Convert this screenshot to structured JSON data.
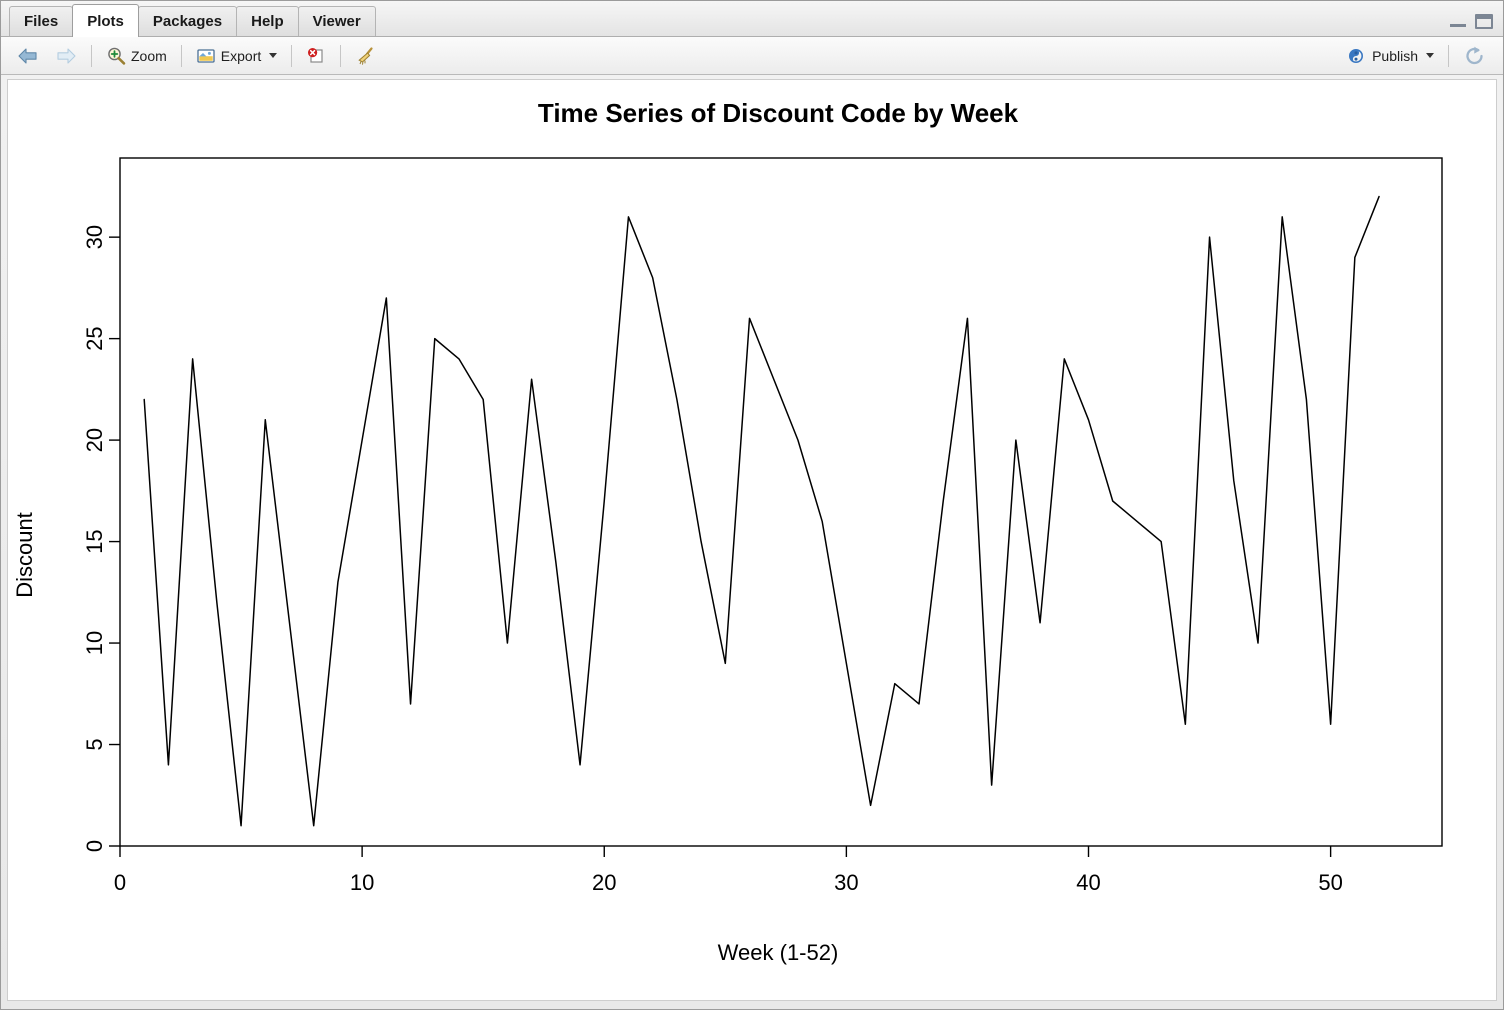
{
  "window": {
    "minimize_icon": "minimize-icon",
    "maximize_icon": "maximize-icon"
  },
  "tabs": [
    {
      "label": "Files",
      "active": false
    },
    {
      "label": "Plots",
      "active": true
    },
    {
      "label": "Packages",
      "active": false
    },
    {
      "label": "Help",
      "active": false
    },
    {
      "label": "Viewer",
      "active": false
    }
  ],
  "toolbar": {
    "back_icon": "back-arrow-icon",
    "forward_icon": "forward-arrow-icon",
    "zoom_label": "Zoom",
    "zoom_icon": "magnifier-plus-icon",
    "export_label": "Export",
    "export_icon": "export-image-icon",
    "export_caret": "chevron-down-icon",
    "remove_icon": "remove-plot-icon",
    "clear_icon": "broom-clear-all-icon",
    "publish_label": "Publish",
    "publish_icon": "publish-icon",
    "publish_caret": "chevron-down-icon",
    "refresh_icon": "refresh-icon"
  },
  "chart_data": {
    "type": "line",
    "title": "Time Series of Discount Code by Week",
    "xlabel": "Week (1-52)",
    "ylabel": "Discount",
    "xlim": [
      1,
      52
    ],
    "ylim": [
      0,
      32
    ],
    "xticks": [
      0,
      10,
      20,
      30,
      40,
      50
    ],
    "yticks": [
      0,
      5,
      10,
      15,
      20,
      25,
      30
    ],
    "grid": false,
    "legend": null,
    "line_color": "#000000",
    "line_width": 1,
    "x": [
      1,
      2,
      3,
      4,
      5,
      6,
      7,
      8,
      9,
      10,
      11,
      12,
      13,
      14,
      15,
      16,
      17,
      18,
      19,
      20,
      21,
      22,
      23,
      24,
      25,
      26,
      27,
      28,
      29,
      30,
      31,
      32,
      33,
      34,
      35,
      36,
      37,
      38,
      39,
      40,
      41,
      42,
      43,
      44,
      45,
      46,
      47,
      48,
      49,
      50,
      51,
      52
    ],
    "values": [
      22,
      4,
      24,
      12,
      1,
      21,
      11,
      1,
      13,
      20,
      27,
      7,
      25,
      24,
      22,
      10,
      23,
      14,
      4,
      17,
      31,
      28,
      22,
      15,
      9,
      26,
      23,
      20,
      16,
      9,
      2,
      8,
      7,
      17,
      26,
      3,
      20,
      11,
      24,
      21,
      17,
      16,
      15,
      6,
      30,
      18,
      10,
      31,
      22,
      6,
      29,
      32
    ],
    "series": [
      {
        "name": "Discount",
        "values": [
          22,
          4,
          24,
          12,
          1,
          21,
          11,
          1,
          13,
          20,
          27,
          7,
          25,
          24,
          22,
          10,
          23,
          14,
          4,
          17,
          31,
          28,
          22,
          15,
          9,
          26,
          23,
          20,
          16,
          9,
          2,
          8,
          7,
          17,
          26,
          3,
          20,
          11,
          24,
          21,
          17,
          16,
          15,
          6,
          30,
          18,
          10,
          31,
          22,
          6,
          29,
          32
        ]
      }
    ]
  }
}
